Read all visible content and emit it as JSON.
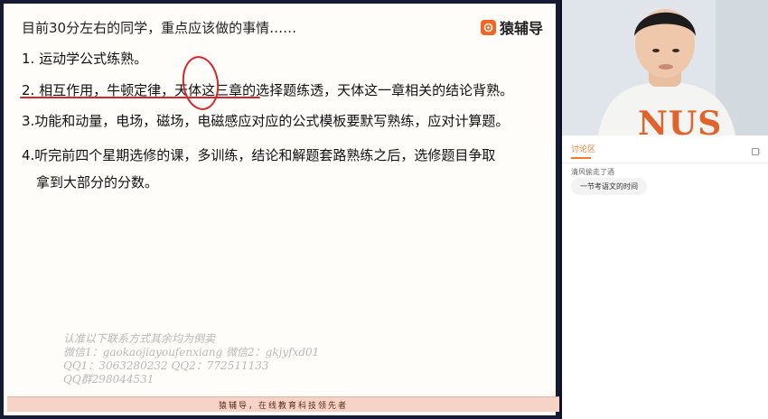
{
  "slide": {
    "title": "目前30分左右的同学，重点应该做的事情……",
    "brand": "猿辅导",
    "points": [
      "1. 运动学公式练熟。",
      "2. 相互作用，牛顿定律，天体这三章的选择题练透，天体这一章相关的结论背熟。",
      "3.功能和动量，电场，磁场，电磁感应对应的公式模板要默写熟练，应对计算题。",
      "4.听完前四个星期选修的课，多训练，结论和解题套路熟练之后，选修题目争取",
      "拿到大部分的分数。"
    ],
    "watermark": [
      "认准以下联系方式其余均为倒卖",
      "微信1：gaokaojiayoufenxiang 微信2：gkjyfxd01",
      "QQ1：3063280232 QQ2：772511133",
      "QQ群298044531"
    ],
    "footer": "猿辅导，在线教育科技领先者"
  },
  "video": {
    "shirt_text": "NUS"
  },
  "chat": {
    "tab_label": "讨论区",
    "system_message": "清风偷走了酒",
    "message": "一节考语文的时间"
  },
  "colors": {
    "brand_orange": "#f26522",
    "annotation_red": "#d7262a",
    "shirt_text": "#e2622b"
  },
  "icons": {
    "logo": "yuanfudao-logo-icon",
    "settings": "chat-settings-icon"
  }
}
